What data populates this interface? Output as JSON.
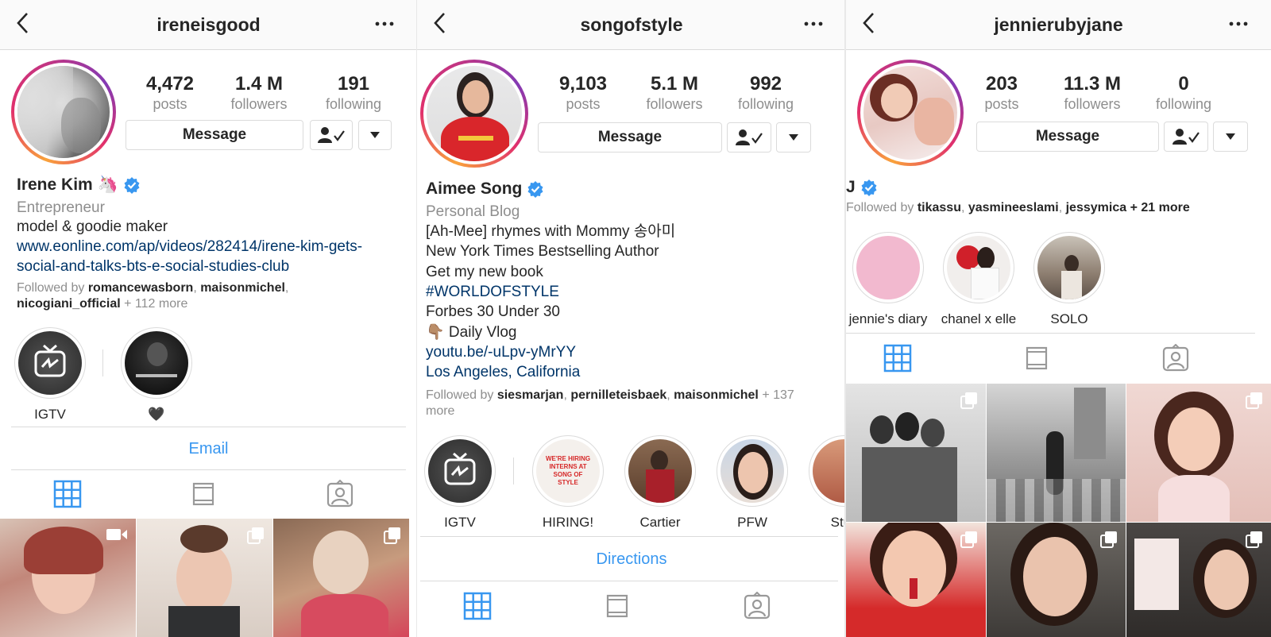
{
  "profiles": [
    {
      "username": "ireneisgood",
      "stats": [
        {
          "value": "4,472",
          "label": "posts"
        },
        {
          "value": "1.4 M",
          "label": "followers"
        },
        {
          "value": "191",
          "label": "following"
        }
      ],
      "message_label": "Message",
      "name": "Irene Kim 🦄",
      "category": "Entrepreneur",
      "bio_lines": [
        "model & goodie maker"
      ],
      "link_lines": [
        "www.eonline.com/ap/videos/282414/irene-kim-gets-",
        "social-and-talks-bts-e-social-studies-club"
      ],
      "followed_by": {
        "prefix": "Followed by ",
        "users": [
          "romancewasborn",
          "maisonmichel",
          "nicogiani_official"
        ],
        "more": "+ 112 more"
      },
      "highlights": [
        {
          "label": "IGTV"
        },
        {
          "label": "🖤"
        }
      ],
      "action_link": "Email"
    },
    {
      "username": "songofstyle",
      "stats": [
        {
          "value": "9,103",
          "label": "posts"
        },
        {
          "value": "5.1 M",
          "label": "followers"
        },
        {
          "value": "992",
          "label": "following"
        }
      ],
      "message_label": "Message",
      "name": "Aimee Song",
      "category": "Personal Blog",
      "bio_lines": [
        "[Ah-Mee] rhymes with Mommy 송아미",
        "New York Times Bestselling Author",
        "Get my new book"
      ],
      "hashtag": "#WORLDOFSTYLE",
      "bio_lines2": [
        "Forbes 30 Under 30",
        "👇🏽 Daily Vlog"
      ],
      "link_lines": [
        "youtu.be/-uLpv-yMrYY",
        "Los Angeles, California"
      ],
      "followed_by": {
        "prefix": "Followed by ",
        "users": [
          "siesmarjan",
          "pernilleteisbaek",
          "maisonmichel"
        ],
        "more": "+ 137 more"
      },
      "highlights": [
        {
          "label": "IGTV"
        },
        {
          "label": "HIRING!"
        },
        {
          "label": "Cartier"
        },
        {
          "label": "PFW"
        },
        {
          "label": "Stuff"
        }
      ],
      "hiring_sign": "WE'RE HIRING INTERNS AT SONG OF STYLE",
      "action_link": "Directions"
    },
    {
      "username": "jennierubyjane",
      "stats": [
        {
          "value": "203",
          "label": "posts"
        },
        {
          "value": "11.3 M",
          "label": "followers"
        },
        {
          "value": "0",
          "label": "following"
        }
      ],
      "message_label": "Message",
      "name": "J",
      "followed_by": {
        "prefix": "Followed by ",
        "users": [
          "tikassu",
          "yasmineeslami",
          "jessymica"
        ],
        "more": "+ 21 more"
      },
      "highlights": [
        {
          "label": "jennie's diary"
        },
        {
          "label": "chanel x elle"
        },
        {
          "label": "SOLO"
        }
      ]
    }
  ],
  "colors": {
    "link_blue": "#3897f0",
    "link_dark": "#003569",
    "verified": "#3897f0",
    "gray": "#8e8e8e"
  },
  "icons": [
    "back-chevron-icon",
    "more-dots-icon",
    "following-check-icon",
    "dropdown-arrow-icon",
    "grid-icon",
    "feed-icon",
    "tagged-icon",
    "verified-badge-icon",
    "igtv-icon",
    "multi-photo-icon",
    "video-icon"
  ]
}
